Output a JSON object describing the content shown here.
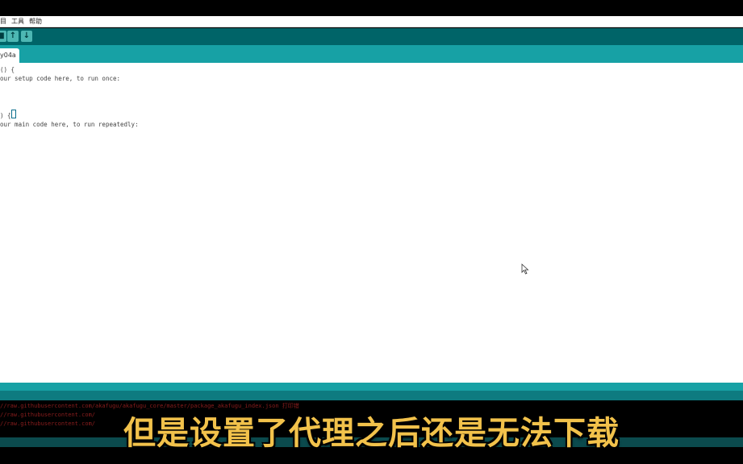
{
  "menubar": {
    "items": [
      "目",
      "工具",
      "帮助"
    ]
  },
  "toolbar": {
    "buttons": [
      {
        "icon": "new-file-icon",
        "glyph": "■"
      },
      {
        "icon": "open-file-icon",
        "glyph": "↑"
      },
      {
        "icon": "save-file-icon",
        "glyph": "↓"
      }
    ]
  },
  "tab": {
    "label": "y04a"
  },
  "code": {
    "line1": "() {",
    "line2": "our setup code here, to run once:",
    "line3": ") {",
    "line4": "our main code here, to run repeatedly:"
  },
  "console": {
    "lines": [
      "//raw.githubusercontent.com/akafugu/akafugu_core/master/package_akafugu_index.json 打印错",
      "//raw.githubusercontent.com/",
      "//raw.githubusercontent.com/"
    ]
  },
  "subtitle": "但是设置了代理之后还是无法下载",
  "colors": {
    "toolbar": "#006468",
    "tabstrip": "#17a1a5",
    "subtitle": "#f2c24b"
  }
}
